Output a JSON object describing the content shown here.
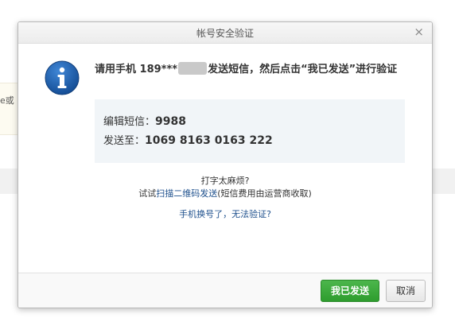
{
  "background": {
    "strip_text": "e或"
  },
  "dialog": {
    "title": "帐号安全验证",
    "close_glyph": "×",
    "prompt_prefix": "请用手机 189***",
    "prompt_suffix": "发送短信，然后点击“我已发送”进行验证",
    "sms": {
      "content_label": "编辑短信：",
      "content_value": "9988",
      "send_to_label": "发送至：",
      "send_to_value": "1069 8163 0163 222"
    },
    "help": {
      "line1": "打字太麻烦?",
      "line2_prefix": "试试",
      "line2_link": "扫描二维码发送",
      "line2_suffix": "(短信费用由运营商收取)",
      "changed_phone_link": "手机换号了，无法验证?"
    },
    "buttons": {
      "sent_label": "我已发送",
      "cancel_label": "取消"
    },
    "colors": {
      "primary": "#3aaa3a",
      "link": "#1d4f8c",
      "info_icon": "#1f5fa8"
    }
  }
}
